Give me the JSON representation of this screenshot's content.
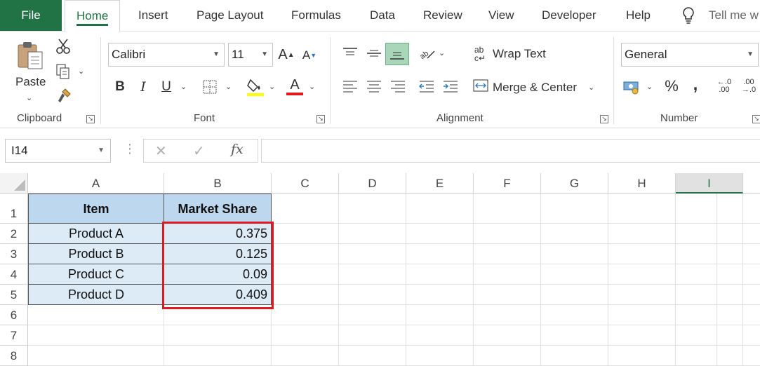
{
  "tabs": {
    "file": "File",
    "home": "Home",
    "insert": "Insert",
    "page_layout": "Page Layout",
    "formulas": "Formulas",
    "data": "Data",
    "review": "Review",
    "view": "View",
    "developer": "Developer",
    "help": "Help",
    "tell_me": "Tell me w"
  },
  "ribbon": {
    "clipboard": {
      "label": "Clipboard",
      "paste": "Paste"
    },
    "font": {
      "label": "Font",
      "name": "Calibri",
      "size": "11"
    },
    "alignment": {
      "label": "Alignment",
      "wrap_text": "Wrap Text",
      "merge_center": "Merge & Center"
    },
    "number": {
      "label": "Number",
      "format": "General"
    }
  },
  "formula_bar": {
    "name_box": "I14",
    "fx": "fx",
    "value": ""
  },
  "columns": [
    "A",
    "B",
    "C",
    "D",
    "E",
    "F",
    "G",
    "H",
    "I"
  ],
  "selected_column": "I",
  "rows": [
    "1",
    "2",
    "3",
    "4",
    "5",
    "6",
    "7",
    "8"
  ],
  "table": {
    "headers": [
      "Item",
      "Market Share"
    ],
    "rows": [
      {
        "item": "Product A",
        "share": "0.375"
      },
      {
        "item": "Product B",
        "share": "0.125"
      },
      {
        "item": "Product C",
        "share": "0.09"
      },
      {
        "item": "Product D",
        "share": "0.409"
      }
    ]
  },
  "colors": {
    "accent": "#217346",
    "header_fill": "#bdd7ee",
    "data_fill": "#ddebf7",
    "highlight": "#e0191f"
  }
}
